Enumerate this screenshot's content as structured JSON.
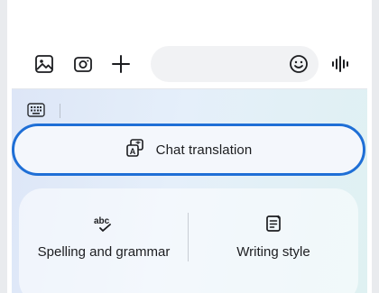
{
  "composer": {
    "icons": [
      "gallery-icon",
      "camera-icon",
      "plus-icon",
      "emoji-icon",
      "voice-input-icon"
    ],
    "message_placeholder": ""
  },
  "ai_panel": {
    "chat_translation_label": "Chat translation",
    "spelling_label": "Spelling and grammar",
    "writing_style_label": "Writing style"
  },
  "colors": {
    "accent": "#1f6fd6",
    "panel_bg": "#e2ecf8",
    "text": "#1c1d20"
  }
}
